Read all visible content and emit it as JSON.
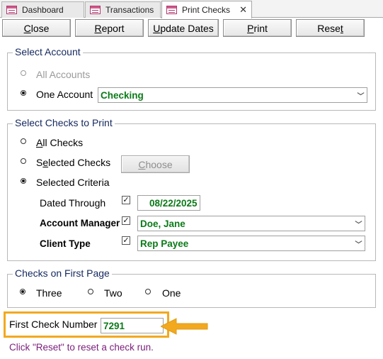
{
  "tabs": [
    {
      "label": "Dashboard",
      "icon": "form-icon"
    },
    {
      "label": "Transactions",
      "icon": "form-icon"
    },
    {
      "label": "Print Checks",
      "icon": "form-icon",
      "active": true
    }
  ],
  "toolbar": {
    "close": {
      "pre": "",
      "ul": "C",
      "post": "lose"
    },
    "report": {
      "pre": "",
      "ul": "R",
      "post": "eport"
    },
    "update": {
      "pre": "",
      "ul": "U",
      "post": "pdate Dates"
    },
    "print": {
      "pre": "",
      "ul": "P",
      "post": "rint"
    },
    "reset": {
      "pre": "Rese",
      "ul": "t",
      "post": ""
    }
  },
  "select_account": {
    "legend": "Select Account",
    "all_accounts": "All Accounts",
    "one_account": "One Account",
    "account_value": "Checking",
    "selected": "one"
  },
  "select_checks": {
    "legend": "Select Checks to Print",
    "all_checks": {
      "ul": "A",
      "post": "ll Checks"
    },
    "selected_checks": {
      "pre": "S",
      "ul": "e",
      "post": "lected Checks"
    },
    "selected_criteria": "Selected Criteria",
    "choose": {
      "ul": "C",
      "post": "hoose"
    },
    "selected": "criteria",
    "dated_through": {
      "label": "Dated Through",
      "checked": true,
      "value": "08/22/2025"
    },
    "account_manager": {
      "label": "Account Manager",
      "checked": true,
      "value": "Doe, Jane"
    },
    "client_type": {
      "label": "Client Type",
      "checked": true,
      "value": "Rep Payee"
    }
  },
  "checks_first_page": {
    "legend": "Checks on First Page",
    "options": [
      "Three",
      "Two",
      "One"
    ],
    "selected": "Three"
  },
  "first_check": {
    "label": "First Check Number",
    "value": "7291"
  },
  "hint": "Click \"Reset\" to reset a check run.",
  "colors": {
    "accent": "#f2a91f",
    "value_text": "#0b7a18",
    "hint": "#7a1e7a",
    "legend": "#14285e"
  }
}
